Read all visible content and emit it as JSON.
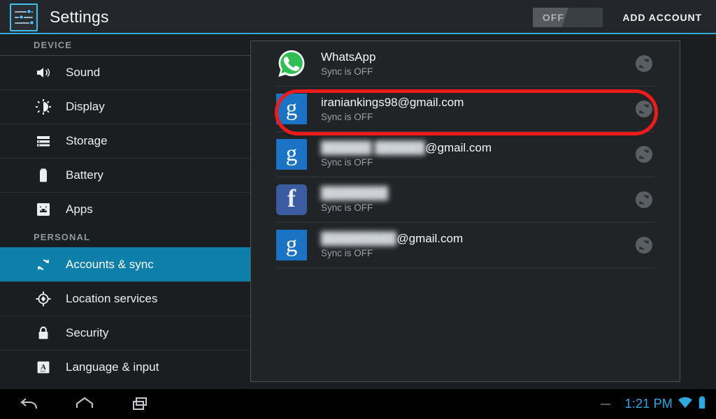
{
  "header": {
    "app_icon": "settings-sliders-icon",
    "title": "Settings",
    "master_toggle": {
      "label": "OFF",
      "state": "off"
    },
    "add_account_label": "ADD ACCOUNT",
    "accent_color": "#33a9d8"
  },
  "sidebar": {
    "sections": [
      {
        "label": "DEVICE",
        "items": [
          {
            "label": "Sound",
            "icon": "speaker-icon",
            "selected": false
          },
          {
            "label": "Display",
            "icon": "brightness-icon",
            "selected": false
          },
          {
            "label": "Storage",
            "icon": "storage-icon",
            "selected": false
          },
          {
            "label": "Battery",
            "icon": "battery-icon",
            "selected": false
          },
          {
            "label": "Apps",
            "icon": "apps-android-icon",
            "selected": false
          }
        ]
      },
      {
        "label": "PERSONAL",
        "items": [
          {
            "label": "Accounts & sync",
            "icon": "sync-icon",
            "selected": true
          },
          {
            "label": "Location services",
            "icon": "location-crosshair-icon",
            "selected": false
          },
          {
            "label": "Security",
            "icon": "lock-icon",
            "selected": false
          },
          {
            "label": "Language & input",
            "icon": "keyboard-letter-icon",
            "selected": false
          }
        ]
      }
    ],
    "selected_color": "#0d7fa8"
  },
  "accounts": [
    {
      "name": "WhatsApp",
      "sync_status": "Sync is OFF",
      "provider_icon": "whatsapp-icon",
      "blurred": false,
      "suffix": "",
      "highlighted": false
    },
    {
      "name": "iraniankings98@gmail.com",
      "sync_status": "Sync is OFF",
      "provider_icon": "google-icon",
      "blurred": false,
      "suffix": "",
      "highlighted": true
    },
    {
      "name": "██████ ██████",
      "sync_status": "Sync is OFF",
      "provider_icon": "google-icon",
      "blurred": true,
      "suffix": "@gmail.com",
      "highlighted": false
    },
    {
      "name": "████████",
      "sync_status": "Sync is OFF",
      "provider_icon": "facebook-icon",
      "blurred": true,
      "suffix": "",
      "highlighted": false
    },
    {
      "name": "█████████",
      "sync_status": "Sync is OFF",
      "provider_icon": "google-icon",
      "blurred": true,
      "suffix": "@gmail.com",
      "highlighted": false
    }
  ],
  "annotation": {
    "shape": "ellipse",
    "color": "#ee1b1b",
    "targets": "iraniankings98@gmail.com account row"
  },
  "navbar": {
    "back_icon": "back-arrow-icon",
    "home_icon": "home-icon",
    "recents_icon": "recent-apps-icon",
    "clock": "1:21 PM",
    "wifi_icon": "wifi-icon",
    "battery_icon": "battery-icon",
    "status_color": "#2ea8e0"
  }
}
